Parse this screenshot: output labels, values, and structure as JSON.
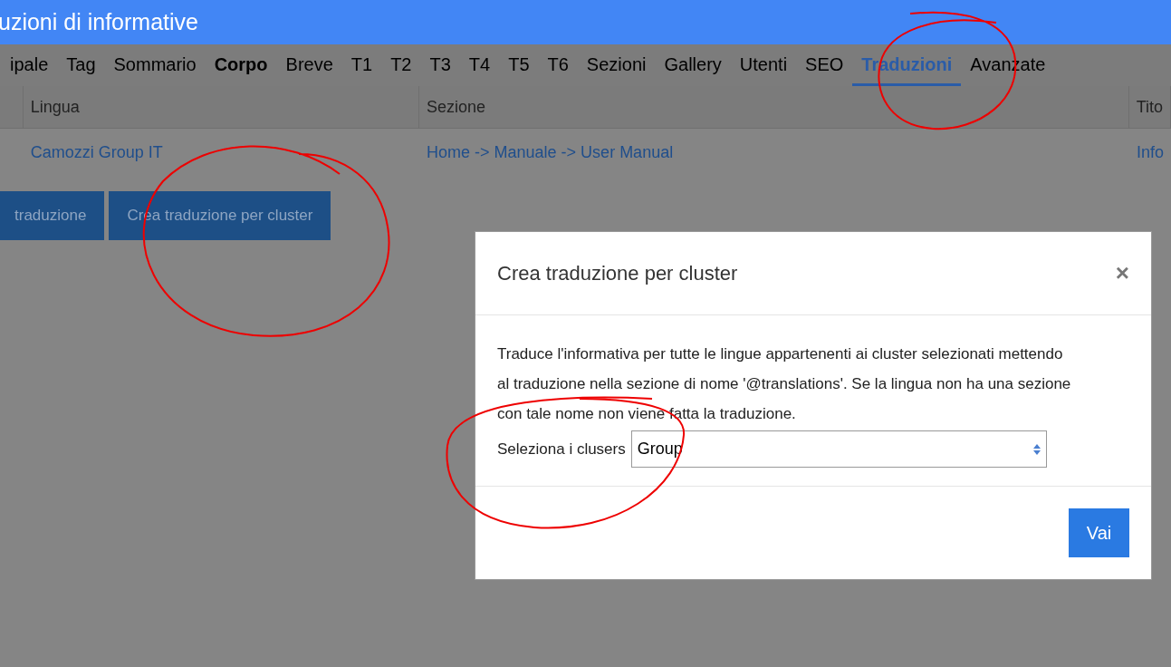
{
  "header": {
    "title": "uzioni di informative"
  },
  "tabs": [
    {
      "label": "ipale",
      "selected": false,
      "emphasized": false
    },
    {
      "label": "Tag",
      "selected": false,
      "emphasized": false
    },
    {
      "label": "Sommario",
      "selected": false,
      "emphasized": false
    },
    {
      "label": "Corpo",
      "selected": false,
      "emphasized": true
    },
    {
      "label": "Breve",
      "selected": false,
      "emphasized": false
    },
    {
      "label": "T1",
      "selected": false,
      "emphasized": false
    },
    {
      "label": "T2",
      "selected": false,
      "emphasized": false
    },
    {
      "label": "T3",
      "selected": false,
      "emphasized": false
    },
    {
      "label": "T4",
      "selected": false,
      "emphasized": false
    },
    {
      "label": "T5",
      "selected": false,
      "emphasized": false
    },
    {
      "label": "T6",
      "selected": false,
      "emphasized": false
    },
    {
      "label": "Sezioni",
      "selected": false,
      "emphasized": false
    },
    {
      "label": "Gallery",
      "selected": false,
      "emphasized": false
    },
    {
      "label": "Utenti",
      "selected": false,
      "emphasized": false
    },
    {
      "label": "SEO",
      "selected": false,
      "emphasized": false
    },
    {
      "label": "Traduzioni",
      "selected": true,
      "emphasized": false
    },
    {
      "label": "Avanzate",
      "selected": false,
      "emphasized": false
    }
  ],
  "table": {
    "columns": [
      "Lingua",
      "Sezione",
      "Tito"
    ],
    "rows": [
      [
        "Camozzi Group IT",
        "Home -> Manuale -> User Manual",
        "Info"
      ]
    ]
  },
  "buttons": [
    "traduzione",
    "Crea traduzione per cluster"
  ],
  "modal": {
    "title": "Crea traduzione per cluster",
    "close": "×",
    "text": "Traduce l'informativa per tutte le lingue appartenenti ai cluster selezionati mettendo al traduzione nella sezione di nome '@translations'. Se la lingua non ha una sezione con tale nome non viene fatta la traduzione.",
    "field_label": "Seleziona i clusers",
    "select_value": "Group",
    "button": "Vai"
  }
}
